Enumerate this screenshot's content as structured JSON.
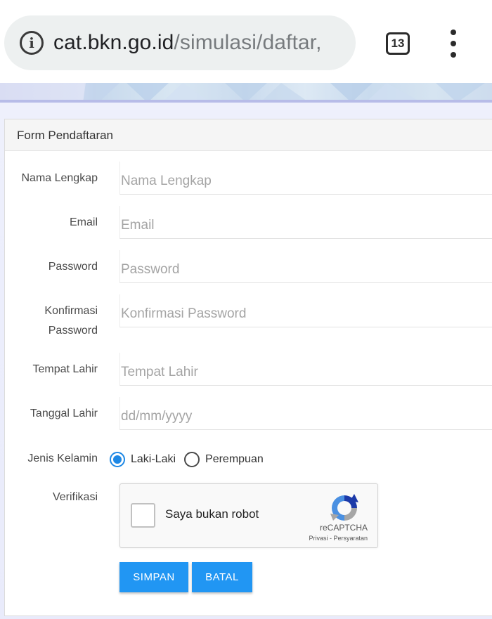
{
  "browser": {
    "url_host": "cat.bkn.go.id",
    "url_path": "/simulasi/daftar,",
    "tab_count": "13"
  },
  "form": {
    "title": "Form Pendaftaran",
    "fields": [
      {
        "label": "Nama Lengkap",
        "placeholder": "Nama Lengkap",
        "value": ""
      },
      {
        "label": "Email",
        "placeholder": "Email",
        "value": ""
      },
      {
        "label": "Password",
        "placeholder": "Password",
        "value": ""
      },
      {
        "label_line1": "Konfirmasi",
        "label_line2": "Password",
        "placeholder": "Konfirmasi Password",
        "value": ""
      },
      {
        "label": "Tempat Lahir",
        "placeholder": "Tempat Lahir",
        "value": ""
      },
      {
        "label": "Tanggal Lahir",
        "placeholder": "dd/mm/yyyy",
        "value": ""
      }
    ],
    "gender": {
      "label": "Jenis Kelamin",
      "options": [
        "Laki-Laki",
        "Perempuan"
      ],
      "selected": "Laki-Laki"
    },
    "verification": {
      "label": "Verifikasi",
      "checkbox_text": "Saya bukan robot",
      "brand": "reCAPTCHA",
      "links": "Privasi - Persyaratan"
    },
    "buttons": {
      "save": "SIMPAN",
      "cancel": "BATAL"
    }
  },
  "colors": {
    "primary_button": "#2196f3",
    "radio_selected": "#1e88e5",
    "page_background": "#eef0fc"
  }
}
